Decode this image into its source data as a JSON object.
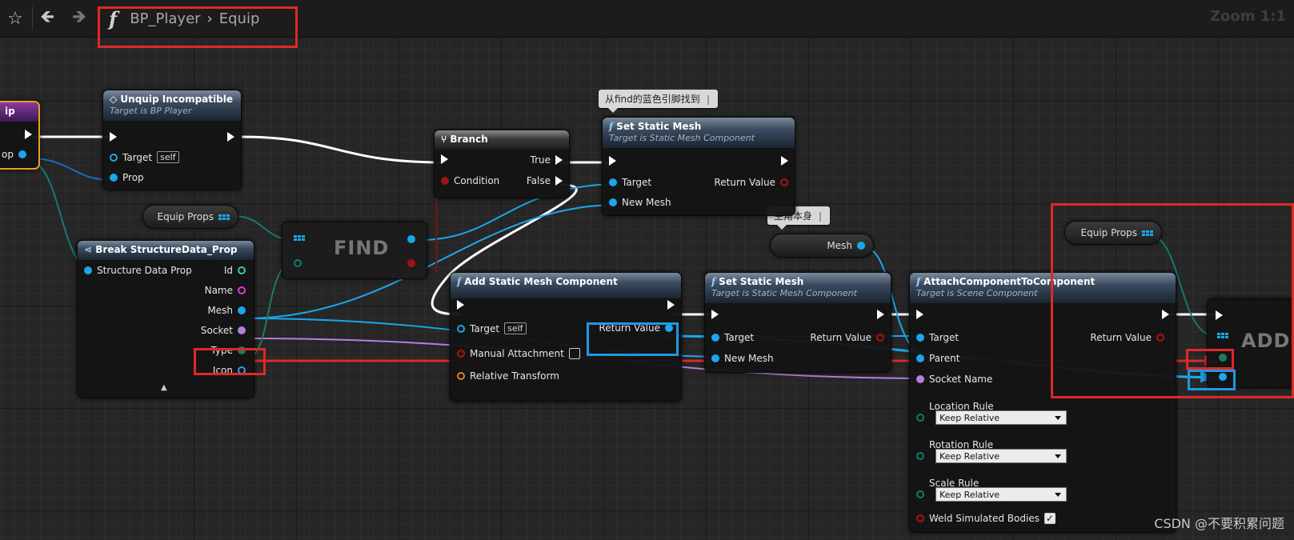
{
  "toolbar": {
    "breadcrumb_function": "BP_Player",
    "breadcrumb_graph": "Equip",
    "zoom": "Zoom 1:1"
  },
  "entry_node": {
    "title": "ip",
    "pin_prop": "op"
  },
  "unequip_node": {
    "title": "Unquip Incompatible",
    "subtitle": "Target is BP Player",
    "pin_target": "Target",
    "self_tag": "self",
    "pin_prop": "Prop"
  },
  "var_equip_props_1": {
    "label": "Equip Props"
  },
  "var_equip_props_2": {
    "label": "Equip Props"
  },
  "break_node": {
    "title": "Break StructureData_Prop",
    "pin_input": "Structure Data Prop",
    "outputs": [
      "Id",
      "Name",
      "Mesh",
      "Socket",
      "Type",
      "Icon"
    ]
  },
  "find_node": {
    "label": "FIND"
  },
  "branch_node": {
    "title": "Branch",
    "pin_condition": "Condition",
    "pin_true": "True",
    "pin_false": "False"
  },
  "comment_find": {
    "text": "从find的蓝色引脚找到"
  },
  "comment_self": {
    "text": "主角本身"
  },
  "set_mesh_1": {
    "title": "Set Static Mesh",
    "subtitle": "Target is Static Mesh Component",
    "pin_target": "Target",
    "pin_new_mesh": "New Mesh",
    "pin_return": "Return Value"
  },
  "mesh_var": {
    "label": "Mesh"
  },
  "add_mesh_node": {
    "title": "Add Static Mesh Component",
    "pin_target": "Target",
    "self_tag": "self",
    "pin_manual": "Manual Attachment",
    "pin_transform": "Relative Transform",
    "pin_return": "Return Value"
  },
  "set_mesh_2": {
    "title": "Set Static Mesh",
    "subtitle": "Target is Static Mesh Component",
    "pin_target": "Target",
    "pin_new_mesh": "New Mesh",
    "pin_return": "Return Value"
  },
  "attach_node": {
    "title": "AttachComponentToComponent",
    "subtitle": "Target is Scene Component",
    "pin_target": "Target",
    "pin_parent": "Parent",
    "pin_socket": "Socket Name",
    "pin_location": "Location Rule",
    "location_value": "Keep Relative",
    "pin_rotation": "Rotation Rule",
    "rotation_value": "Keep Relative",
    "pin_scale": "Scale Rule",
    "scale_value": "Keep Relative",
    "pin_weld": "Weld Simulated Bodies",
    "pin_return": "Return Value"
  },
  "add_node": {
    "label": "ADD"
  },
  "watermark": "CSDN @不要积累问题",
  "colors": {
    "exec_wire": "#ffffff",
    "object_wire": "#1aa7ec",
    "struct_wire": "#137a72",
    "name_wire": "#b47ee0",
    "highlight_red": "#e02828",
    "highlight_blue": "#1e9ae0"
  }
}
